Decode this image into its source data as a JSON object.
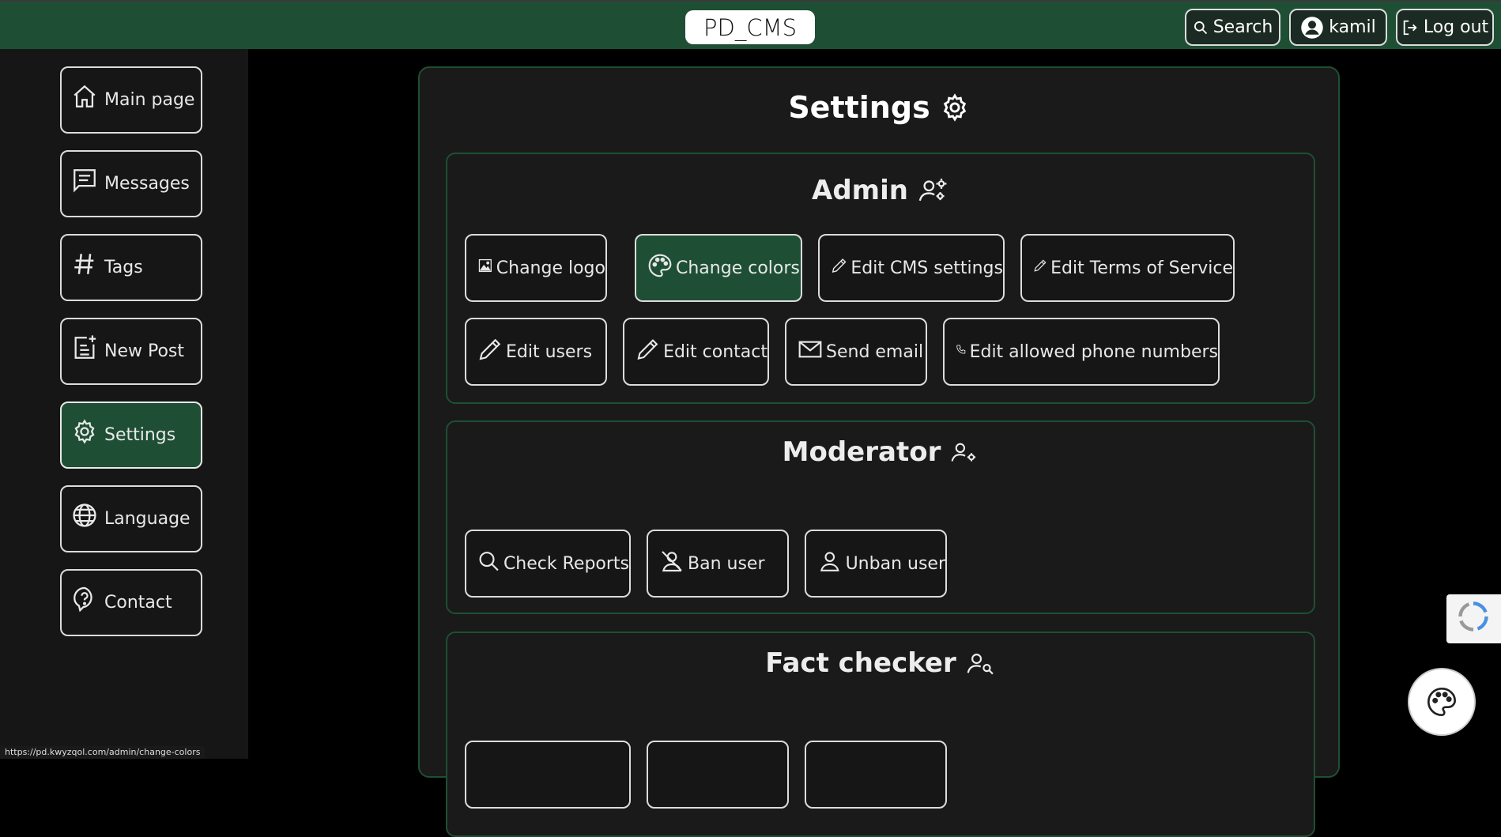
{
  "header": {
    "brand": "PD_CMS",
    "search_label": "Search",
    "user_label": "kamil",
    "logout_label": "Log out"
  },
  "sidebar": {
    "items": [
      {
        "label": "Main page",
        "icon": "home-icon"
      },
      {
        "label": "Messages",
        "icon": "message-icon"
      },
      {
        "label": "Tags",
        "icon": "hash-icon"
      },
      {
        "label": "New Post",
        "icon": "new-post-icon"
      },
      {
        "label": "Settings",
        "icon": "gear-icon",
        "active": true
      },
      {
        "label": "Language",
        "icon": "globe-icon"
      },
      {
        "label": "Contact",
        "icon": "question-icon"
      }
    ]
  },
  "main": {
    "title": "Settings",
    "sections": {
      "admin": {
        "title": "Admin",
        "buttons": [
          {
            "label": "Change logo",
            "icon": "image-icon"
          },
          {
            "label": "Change colors",
            "icon": "palette-icon",
            "active": true
          },
          {
            "label": "Edit CMS settings",
            "icon": "pencil-icon"
          },
          {
            "label": "Edit Terms of Service",
            "icon": "pencil-icon"
          },
          {
            "label": "Edit users",
            "icon": "pencil-icon"
          },
          {
            "label": "Edit contact",
            "icon": "pencil-icon"
          },
          {
            "label": "Send email",
            "icon": "envelope-icon"
          },
          {
            "label": "Edit allowed phone numbers",
            "icon": "phone-icon"
          }
        ]
      },
      "moderator": {
        "title": "Moderator",
        "buttons": [
          {
            "label": "Check Reports",
            "icon": "search-icon"
          },
          {
            "label": "Ban user",
            "icon": "user-slash-icon"
          },
          {
            "label": "Unban user",
            "icon": "user-icon"
          }
        ]
      },
      "fact_checker": {
        "title": "Fact checker"
      }
    }
  },
  "status_url": "https://pd.kwyzqol.com/admin/change-colors",
  "colors": {
    "accent": "#1e4f35",
    "background": "#000000",
    "panel": "#1a1a1a"
  }
}
